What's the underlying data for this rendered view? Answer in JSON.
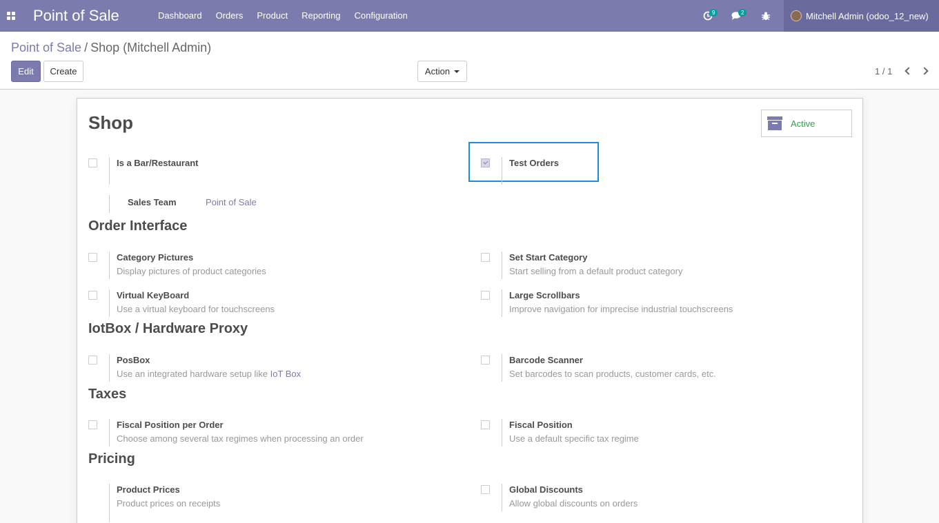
{
  "navbar": {
    "app_title": "Point of Sale",
    "menu": [
      "Dashboard",
      "Orders",
      "Product",
      "Reporting",
      "Configuration"
    ],
    "activity_count": "9",
    "messages_count": "2",
    "user": "Mitchell Admin (odoo_12_new)"
  },
  "control_panel": {
    "breadcrumb_parent": "Point of Sale",
    "breadcrumb_separator": "/",
    "breadcrumb_current": "Shop (Mitchell Admin)",
    "edit_label": "Edit",
    "create_label": "Create",
    "action_label": "Action",
    "pager": "1 / 1"
  },
  "form": {
    "name": "Shop",
    "active_label": "Active",
    "is_bar": {
      "label": "Is a Bar/Restaurant",
      "checked": false
    },
    "test_orders": {
      "label": "Test Orders",
      "checked": true
    },
    "sales_team": {
      "label": "Sales Team",
      "value": "Point of Sale"
    },
    "sections": {
      "order_interface": "Order Interface",
      "iot": "IotBox / Hardware Proxy",
      "taxes": "Taxes",
      "pricing": "Pricing"
    },
    "settings": {
      "category_pictures": {
        "label": "Category Pictures",
        "desc": "Display pictures of product categories"
      },
      "set_start_category": {
        "label": "Set Start Category",
        "desc": "Start selling from a default product category"
      },
      "virtual_keyboard": {
        "label": "Virtual KeyBoard",
        "desc": "Use a virtual keyboard for touchscreens"
      },
      "large_scrollbars": {
        "label": "Large Scrollbars",
        "desc": "Improve navigation for imprecise industrial touchscreens"
      },
      "posbox": {
        "label": "PosBox",
        "desc": "Use an integrated hardware setup like",
        "link": "IoT Box"
      },
      "barcode_scanner": {
        "label": "Barcode Scanner",
        "desc": "Set barcodes to scan products, customer cards, etc."
      },
      "fiscal_position_per_order": {
        "label": "Fiscal Position per Order",
        "desc": "Choose among several tax regimes when processing an order"
      },
      "fiscal_position": {
        "label": "Fiscal Position",
        "desc": "Use a default specific tax regime"
      },
      "product_prices": {
        "label": "Product Prices",
        "desc": "Product prices on receipts"
      },
      "global_discounts": {
        "label": "Global Discounts",
        "desc": "Allow global discounts on orders"
      }
    }
  }
}
